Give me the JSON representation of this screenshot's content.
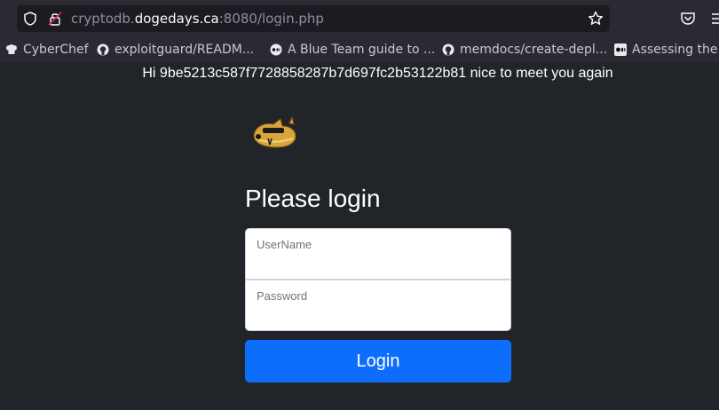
{
  "browser": {
    "url_prefix": "cryptodb.",
    "url_host": "dogedays.ca",
    "url_suffix": ":8080/login.php"
  },
  "bookmarks": [
    {
      "label": "CyberChef",
      "icon": "chef-hat-icon"
    },
    {
      "label": "exploitguard/READM...",
      "icon": "github-icon"
    },
    {
      "label": "A Blue Team guide to ...",
      "icon": "medium-icon"
    },
    {
      "label": "memdocs/create-depl...",
      "icon": "github-icon"
    },
    {
      "label": "Assessing the e",
      "icon": "medium-icon"
    }
  ],
  "page": {
    "greeting": "Hi 9be5213c587f7728858287b7d697fc2b53122b81 nice to meet you again",
    "heading": "Please login",
    "username_placeholder": "UserName",
    "password_placeholder": "Password",
    "login_label": "Login"
  },
  "colors": {
    "background": "#212529",
    "primary_button": "#0d6efd"
  }
}
